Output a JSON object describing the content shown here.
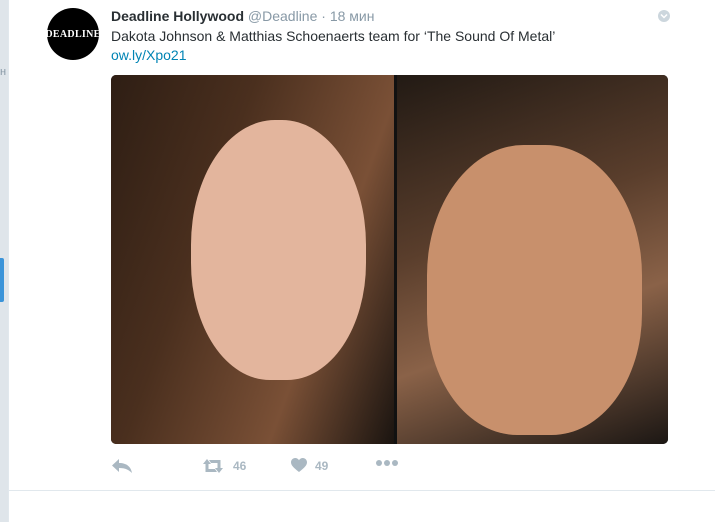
{
  "tweet": {
    "avatar_text": "DEADLINE",
    "name": "Deadline Hollywood",
    "handle": "@Deadline",
    "separator": "·",
    "time": "18 мин",
    "text": "Dakota Johnson & Matthias Schoenaerts team for ‘The Sound Of Metal’",
    "link": "ow.ly/Xpo21"
  },
  "actions": {
    "reply_icon": "reply-icon",
    "retweet_icon": "retweet-icon",
    "retweet_count": "46",
    "like_icon": "heart-icon",
    "like_count": "49",
    "more_icon": "more-icon"
  },
  "colors": {
    "background": "#e6ecf0",
    "card": "#ffffff",
    "name": "#292f33",
    "meta": "#8899a6",
    "link": "#0084b4",
    "action": "#aab8c2",
    "accent": "#3b94d9"
  }
}
